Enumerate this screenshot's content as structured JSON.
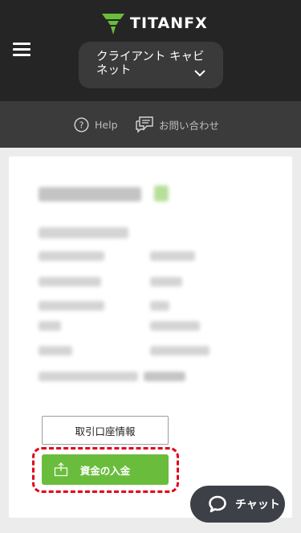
{
  "header": {
    "logo_text": "TITANFX",
    "cabinet_label": "クライアント キャビネット"
  },
  "subbar": {
    "help_label": "Help",
    "contact_label": "お問い合わせ"
  },
  "card": {
    "account_info_button": "取引口座情報",
    "deposit_button": "資金の入金"
  },
  "chat": {
    "label": "チャット"
  },
  "colors": {
    "header_bg": "#252525",
    "accent_green": "#6abd3c",
    "highlight_red": "#e0001b",
    "chat_bg": "#3d4046"
  },
  "icons": [
    "hamburger-menu-icon",
    "chevron-down-icon",
    "help-circle-icon",
    "contact-chat-icon",
    "deposit-box-icon",
    "chat-bubble-icon"
  ]
}
